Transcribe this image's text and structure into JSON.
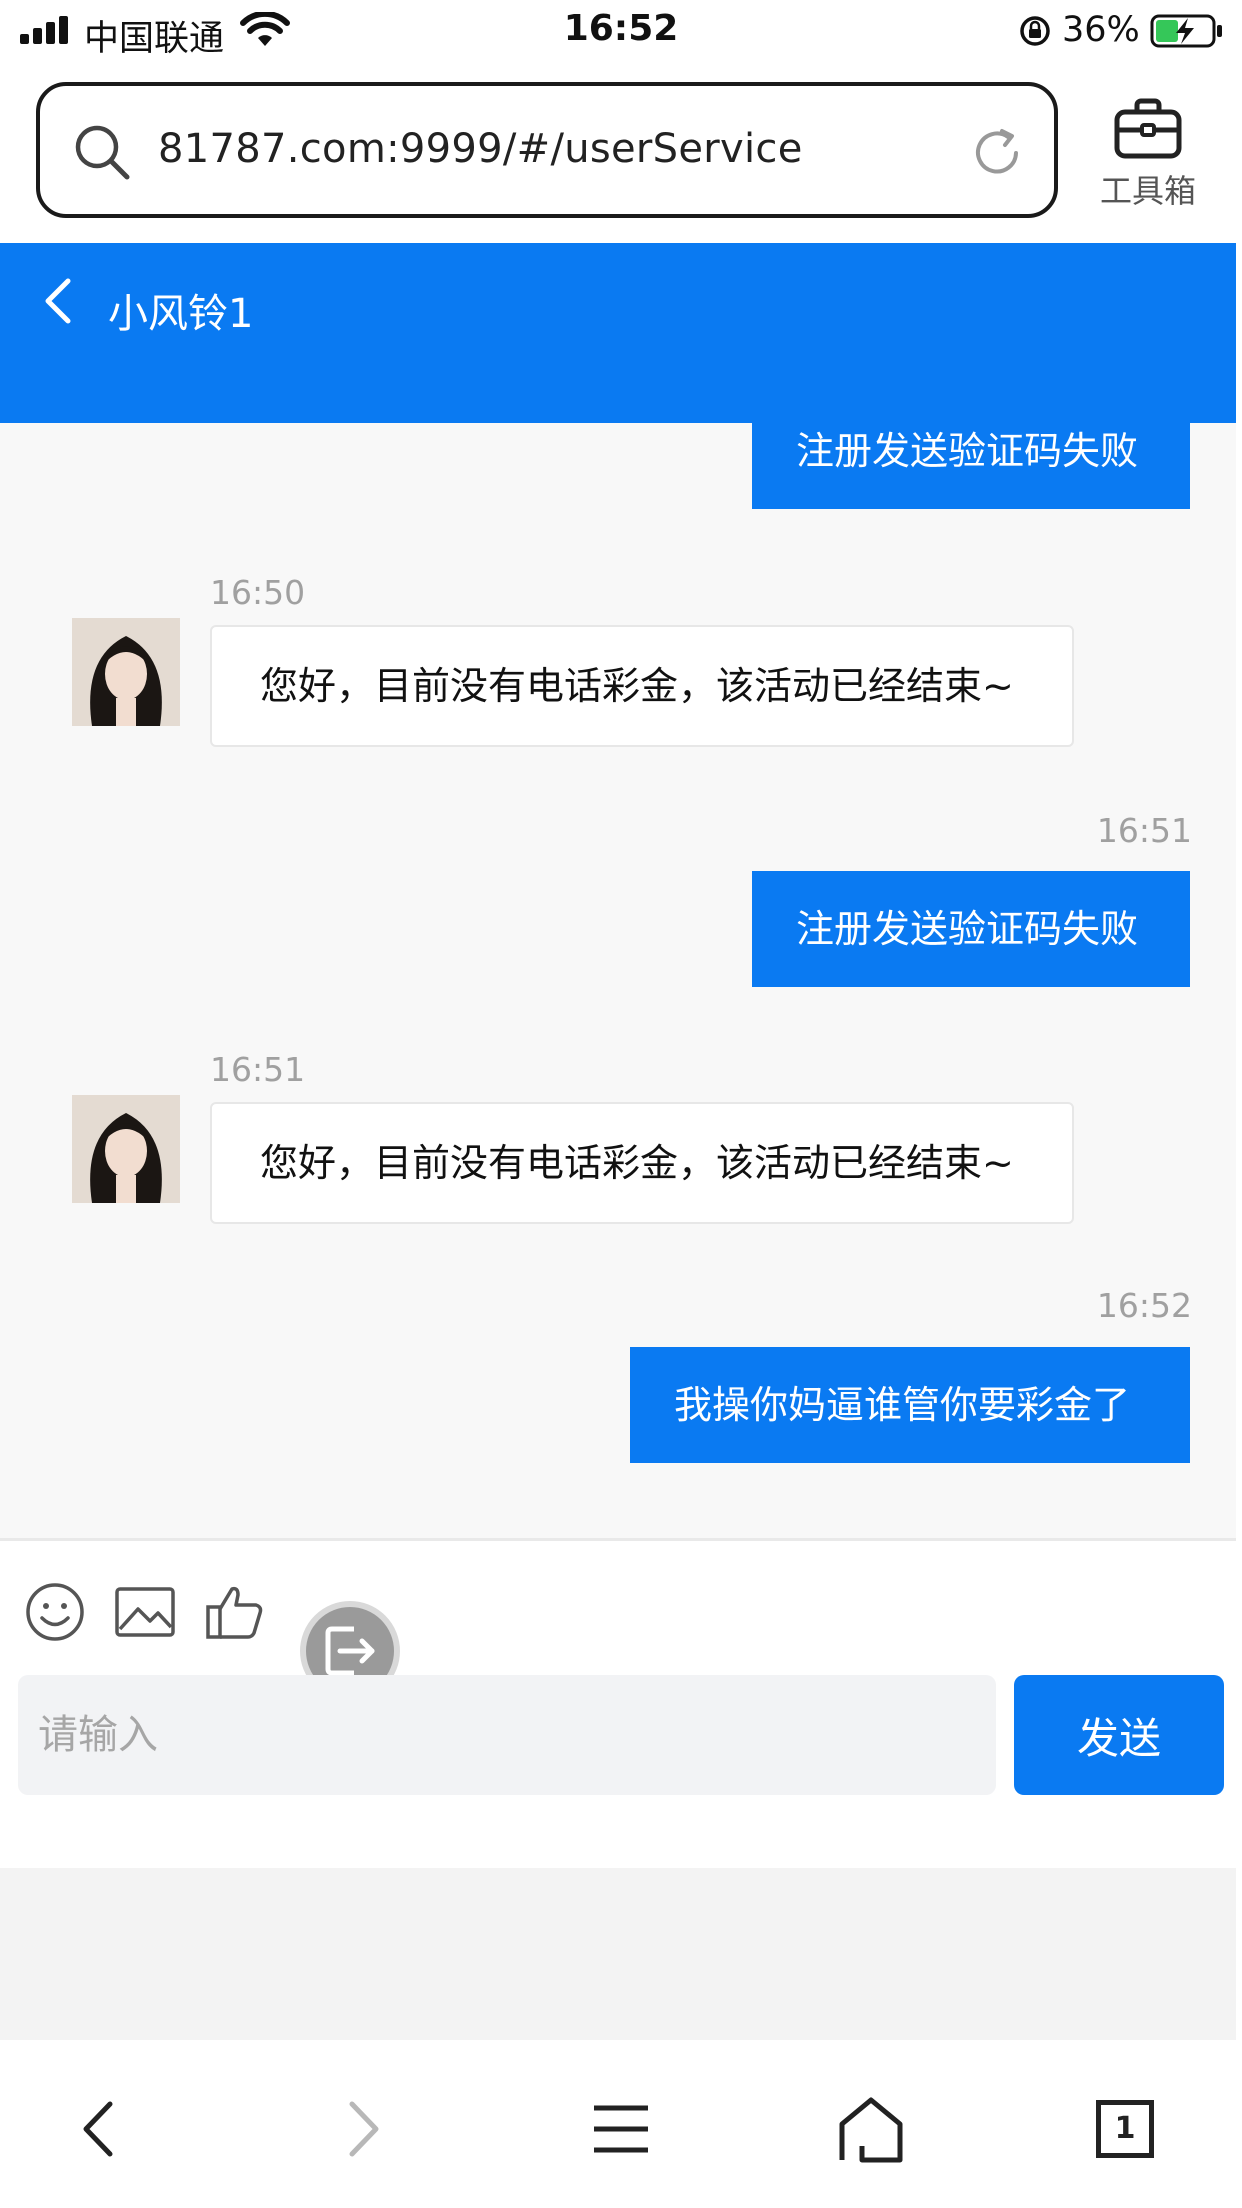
{
  "status_bar": {
    "carrier": "中国联通",
    "time": "16:52",
    "battery": "36%"
  },
  "browser": {
    "url": "81787.com:9999/#/userService",
    "toolbox_label": "工具箱"
  },
  "header": {
    "title": "小风铃1"
  },
  "messages": {
    "m1": {
      "text": "注册发送验证码失败"
    },
    "m2": {
      "time": "16:50",
      "text": "您好，目前没有电话彩金，该活动已经结束~"
    },
    "m3": {
      "time": "16:51",
      "text": "注册发送验证码失败"
    },
    "m4": {
      "time": "16:51",
      "text": "您好，目前没有电话彩金，该活动已经结束~"
    },
    "m5": {
      "time": "16:52",
      "text": "我操你妈逼谁管你要彩金了"
    }
  },
  "composer": {
    "placeholder": "请输入",
    "send_label": "发送"
  },
  "bottom_nav": {
    "tab_count": "1"
  },
  "colors": {
    "accent": "#0a7af2"
  },
  "icons": [
    "signal-icon",
    "wifi-icon",
    "rotation-lock-icon",
    "battery-icon",
    "search-icon",
    "reload-icon",
    "toolbox-icon",
    "back-icon",
    "emoji-icon",
    "image-icon",
    "thumbs-up-icon",
    "logout-icon",
    "nav-back-icon",
    "nav-forward-icon",
    "menu-icon",
    "home-icon",
    "tabs-icon"
  ]
}
